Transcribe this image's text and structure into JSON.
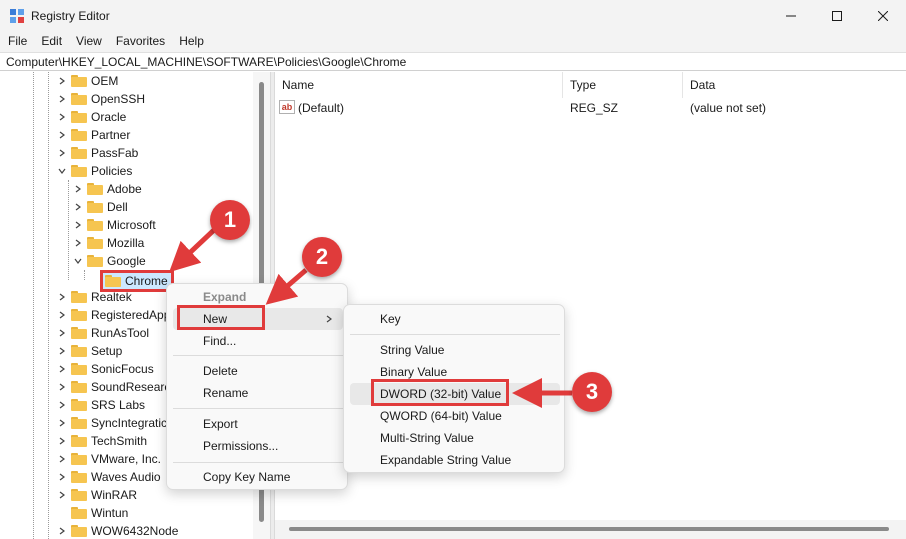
{
  "window": {
    "title": "Registry Editor"
  },
  "menu": [
    "File",
    "Edit",
    "View",
    "Favorites",
    "Help"
  ],
  "address": "Computer\\HKEY_LOCAL_MACHINE\\SOFTWARE\\Policies\\Google\\Chrome",
  "tree": [
    {
      "label": "OEM"
    },
    {
      "label": "OpenSSH"
    },
    {
      "label": "Oracle"
    },
    {
      "label": "Partner"
    },
    {
      "label": "PassFab"
    },
    {
      "label": "Policies"
    },
    {
      "label": "Adobe"
    },
    {
      "label": "Dell"
    },
    {
      "label": "Microsoft"
    },
    {
      "label": "Mozilla"
    },
    {
      "label": "Google"
    },
    {
      "label": "Chrome"
    },
    {
      "label": "Realtek"
    },
    {
      "label": "RegisteredApp"
    },
    {
      "label": "RunAsTool"
    },
    {
      "label": "Setup"
    },
    {
      "label": "SonicFocus"
    },
    {
      "label": "SoundResearc"
    },
    {
      "label": "SRS Labs"
    },
    {
      "label": "SyncIntegratic"
    },
    {
      "label": "TechSmith"
    },
    {
      "label": "VMware, Inc."
    },
    {
      "label": "Waves Audio"
    },
    {
      "label": "WinRAR"
    },
    {
      "label": "Wintun"
    },
    {
      "label": "WOW6432Node"
    }
  ],
  "list": {
    "columns": [
      "Name",
      "Type",
      "Data"
    ],
    "rows": [
      {
        "name": "(Default)",
        "type": "REG_SZ",
        "data": "(value not set)",
        "icon": "ab"
      }
    ]
  },
  "context_menu": {
    "expand": "Expand",
    "new": "New",
    "find": "Find...",
    "delete": "Delete",
    "rename": "Rename",
    "export": "Export",
    "permissions": "Permissions...",
    "copy_key_name": "Copy Key Name"
  },
  "submenu": {
    "key": "Key",
    "string_value": "String Value",
    "binary_value": "Binary Value",
    "dword_value": "DWORD (32-bit) Value",
    "qword_value": "QWORD (64-bit) Value",
    "multi_string_value": "Multi-String Value",
    "expandable_string_value": "Expandable String Value"
  },
  "annotations": {
    "step1": "1",
    "step2": "2",
    "step3": "3"
  },
  "colors": {
    "highlight": "#e03b3b",
    "folder": "#f6c550",
    "selection": "#cce8ff"
  }
}
